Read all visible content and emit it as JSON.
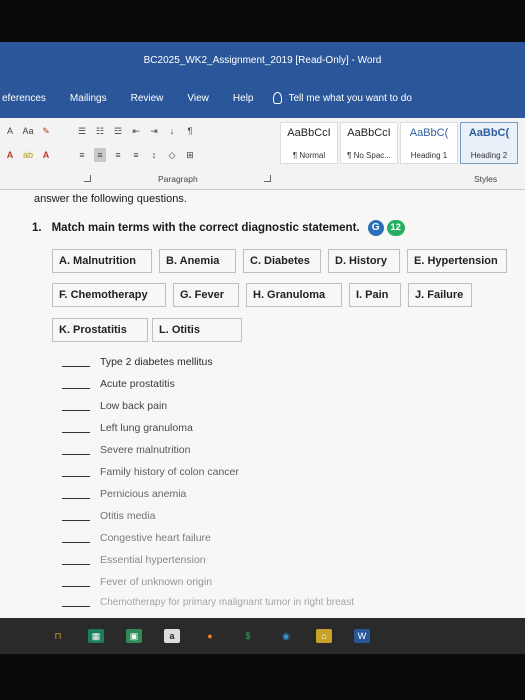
{
  "window": {
    "title": "BC2025_WK2_Assignment_2019 [Read-Only] - Word"
  },
  "menu": {
    "tabs": [
      "eferences",
      "Mailings",
      "Review",
      "View",
      "Help"
    ],
    "tell_me": "Tell me what you want to do"
  },
  "ribbon": {
    "font_size_label": "Aa",
    "paragraph_label": "Paragraph",
    "styles_label": "Styles",
    "styles": [
      {
        "sample": "AaBbCcI",
        "name": "¶ Normal"
      },
      {
        "sample": "AaBbCcI",
        "name": "¶ No Spac..."
      },
      {
        "sample": "AaBbC(",
        "name": "Heading 1"
      },
      {
        "sample": "AaBbC(",
        "name": "Heading 2"
      }
    ]
  },
  "document": {
    "intro": "answer the following questions.",
    "question": {
      "number": "1.",
      "text": "Match main terms with the correct diagnostic statement.",
      "badge_letter": "G",
      "badge_count": "12"
    },
    "terms": [
      "A. Malnutrition",
      "B. Anemia",
      "C. Diabetes",
      "D. History",
      "E. Hypertension",
      "F. Chemotherapy",
      "G. Fever",
      "H. Granuloma",
      "I. Pain",
      "J. Failure",
      "K. Prostatitis",
      "L. Otitis"
    ],
    "statements": [
      "Type 2 diabetes mellitus",
      "Acute prostatitis",
      "Low back pain",
      "Left lung granuloma",
      "Severe malnutrition",
      "Family history of colon cancer",
      "Pernicious anemia",
      "Otitis media",
      "Congestive heart failure",
      "Essential hypertension",
      "Fever of unknown origin",
      "Chemotherapy for primary malignant tumor in right breast"
    ]
  },
  "taskbar": {
    "app_letter": "a"
  },
  "colors": {
    "word_blue": "#2b579a",
    "badge_blue": "#2a6ebb",
    "badge_green": "#27ae60"
  }
}
